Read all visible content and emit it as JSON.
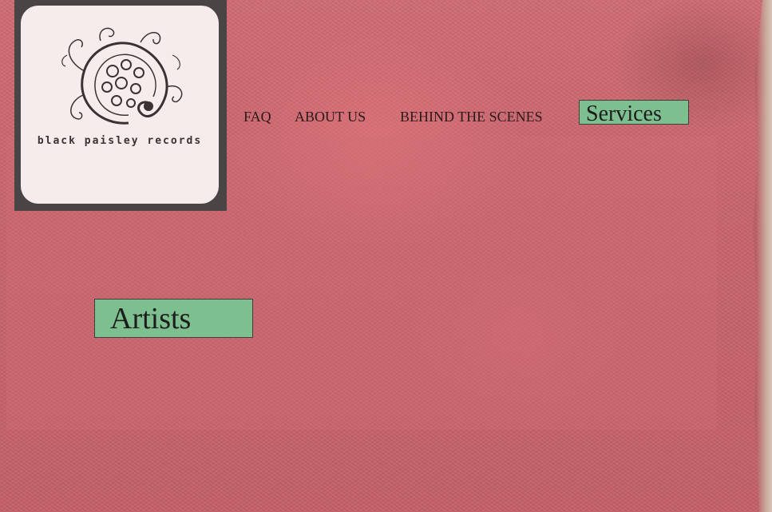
{
  "brand": {
    "name": "black paisley records",
    "logo_icon": "paisley-icon"
  },
  "nav": {
    "items": [
      {
        "label": "FAQ"
      },
      {
        "label": "ABOUT US"
      },
      {
        "label": "BEHIND THE SCENES"
      }
    ],
    "services_label": "Services"
  },
  "main": {
    "artists_label": "Artists"
  },
  "colors": {
    "background": "#c9656e",
    "button_fill": "#7ebf8f",
    "button_border": "#3f3f3f",
    "logo_frame": "#4a4545",
    "logo_card": "#f7ecec",
    "nav_text": "#2a1a1a"
  }
}
